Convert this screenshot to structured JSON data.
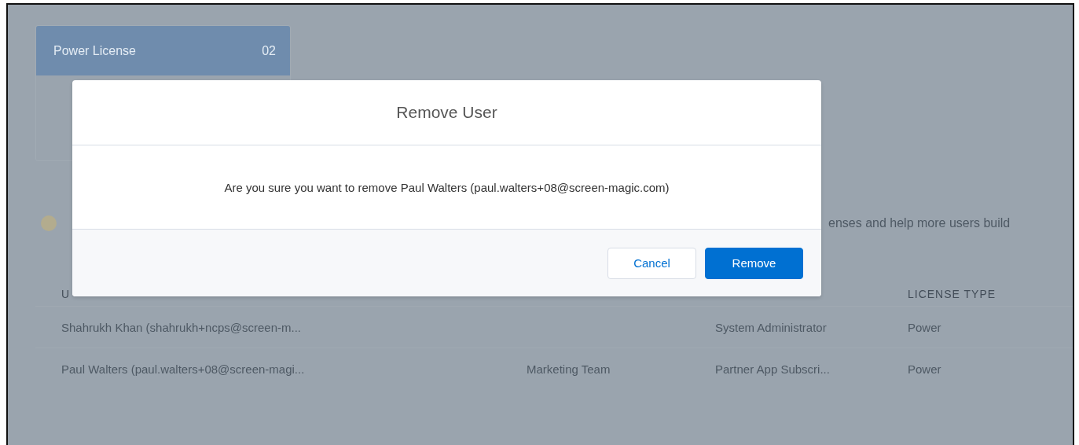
{
  "license_card": {
    "title": "Power License",
    "count": "02"
  },
  "notice": {
    "text": "enses and help more users build"
  },
  "table": {
    "columns": [
      "U",
      "LICENSE TYPE"
    ],
    "rows": [
      {
        "user": "Shahrukh Khan (shahrukh+ncps@screen-m...",
        "group": "",
        "profile": "System Administrator",
        "license_type": "Power"
      },
      {
        "user": "Paul Walters (paul.walters+08@screen-magi...",
        "group": "Marketing Team",
        "profile": "Partner App Subscri...",
        "license_type": "Power"
      }
    ]
  },
  "dialog": {
    "title": "Remove User",
    "message": "Are you sure you want to remove Paul Walters (paul.walters+08@screen-magic.com)",
    "buttons": [
      {
        "label": "Cancel",
        "kind": "secondary"
      },
      {
        "label": "Remove",
        "kind": "primary"
      }
    ]
  }
}
